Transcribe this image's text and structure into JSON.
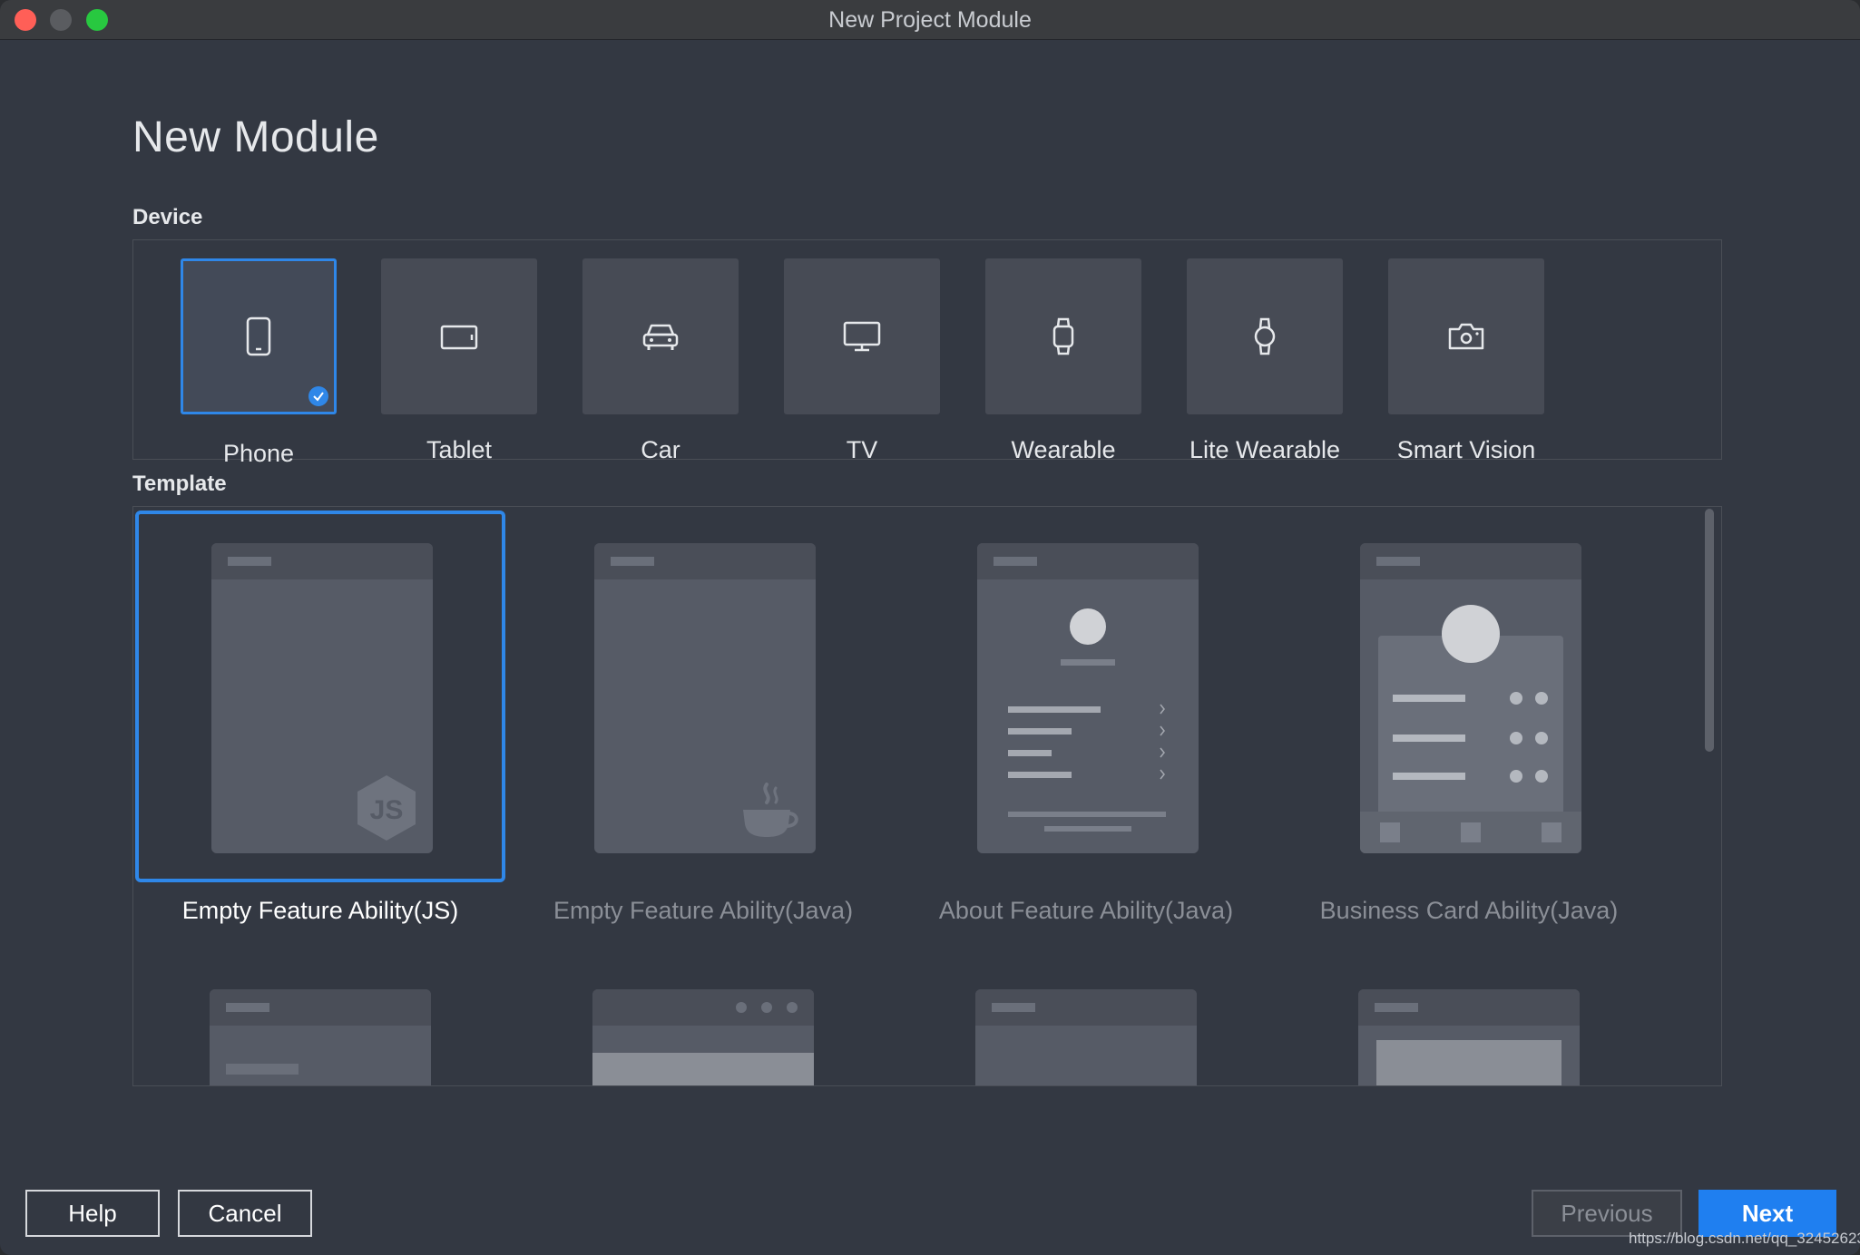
{
  "window": {
    "title": "New Project Module"
  },
  "page": {
    "heading": "New Module"
  },
  "device_section": {
    "label": "Device",
    "items": [
      {
        "label": "Phone",
        "icon": "phone-icon",
        "selected": true
      },
      {
        "label": "Tablet",
        "icon": "tablet-icon"
      },
      {
        "label": "Car",
        "icon": "car-icon"
      },
      {
        "label": "TV",
        "icon": "tv-icon"
      },
      {
        "label": "Wearable",
        "icon": "watch-icon"
      },
      {
        "label": "Lite Wearable",
        "icon": "round-watch-icon"
      },
      {
        "label": "Smart Vision",
        "icon": "camera-icon"
      }
    ]
  },
  "template_section": {
    "label": "Template",
    "items": [
      {
        "label": "Empty Feature Ability(JS)",
        "selected": true,
        "badge": "JS"
      },
      {
        "label": "Empty Feature Ability(Java)",
        "badge": "java-cup-icon"
      },
      {
        "label": "About Feature Ability(Java)"
      },
      {
        "label": "Business Card Ability(Java)"
      }
    ]
  },
  "buttons": {
    "help": "Help",
    "cancel": "Cancel",
    "previous": "Previous",
    "next": "Next"
  },
  "footer": {
    "watermark": "https://blog.csdn.net/qq_32452623"
  },
  "colors": {
    "accent": "#2f87e8",
    "next_button": "#1f7ff0",
    "background": "#333842"
  }
}
